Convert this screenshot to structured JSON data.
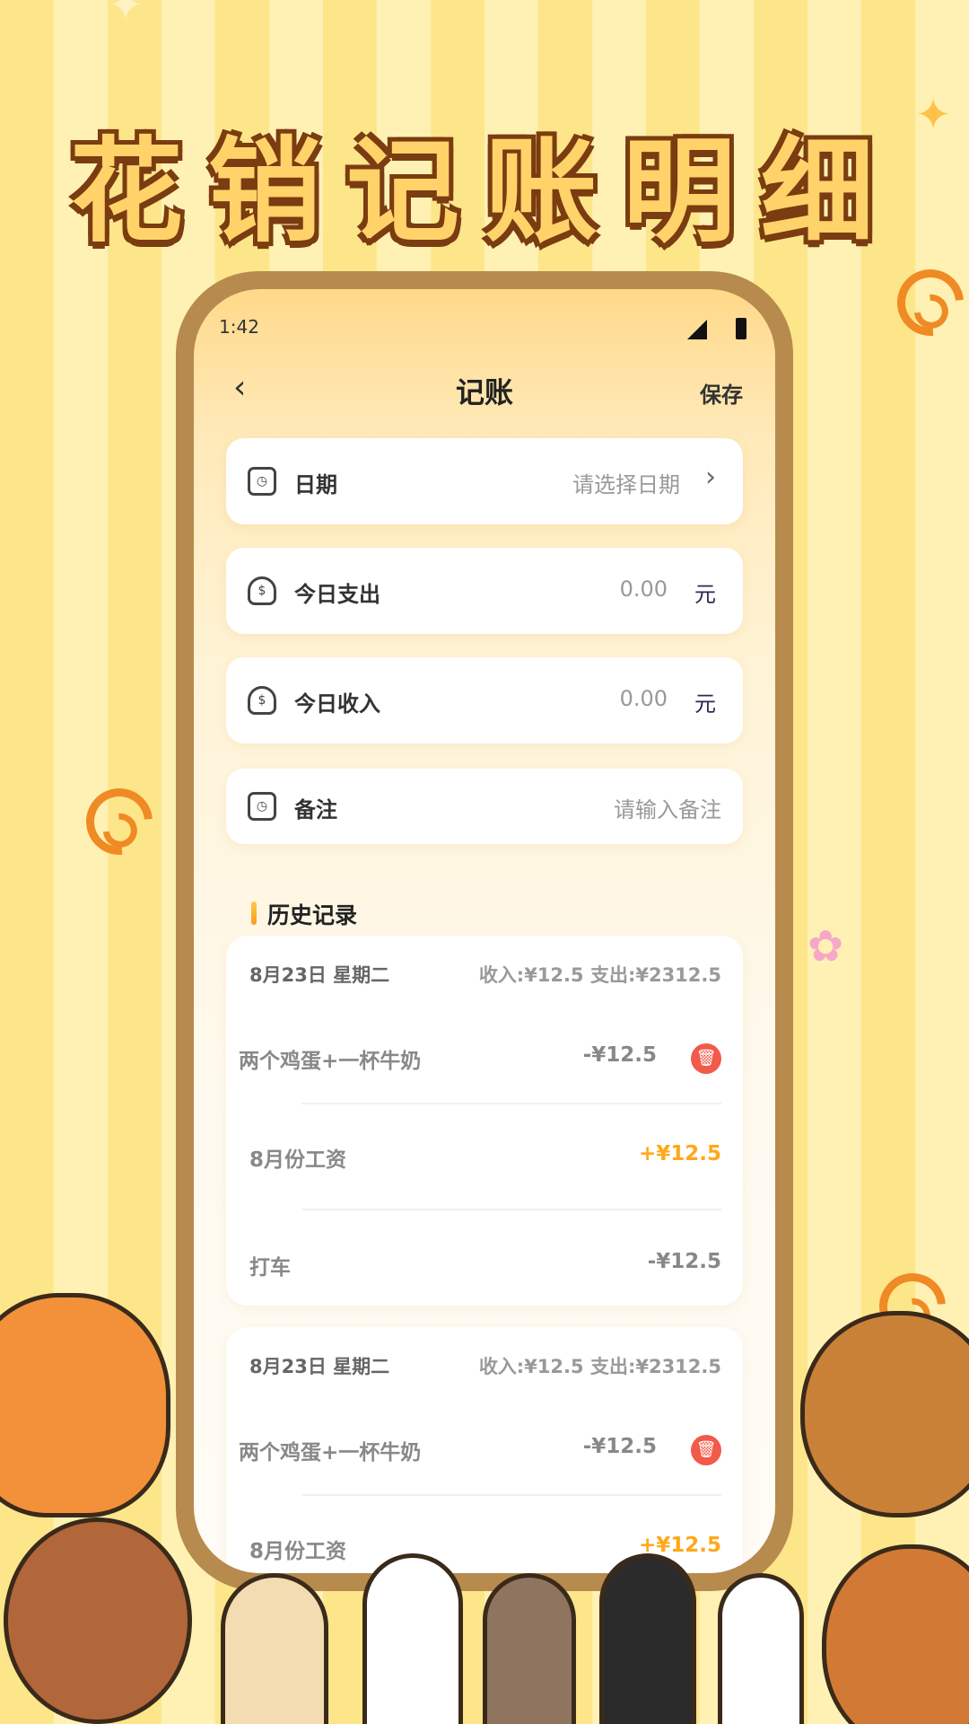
{
  "promo": {
    "title": "花销记账明细"
  },
  "status_bar": {
    "time": "1:42"
  },
  "nav": {
    "back_icon": "chevron-left-icon",
    "title": "记账",
    "save": "保存"
  },
  "form": {
    "date": {
      "label": "日期",
      "placeholder": "请选择日期",
      "icon": "clock-icon"
    },
    "expense": {
      "label": "今日支出",
      "value": "0.00",
      "unit": "元",
      "icon": "money-bag-icon"
    },
    "income": {
      "label": "今日收入",
      "value": "0.00",
      "unit": "元",
      "icon": "money-bag-icon"
    },
    "note": {
      "label": "备注",
      "placeholder": "请输入备注",
      "icon": "clock-icon"
    }
  },
  "history": {
    "title": "历史记录",
    "groups": [
      {
        "date": "8月23日  星期二",
        "summary": "收入:¥12.5   支出:¥2312.5",
        "items": [
          {
            "name": "两个鸡蛋+一杯牛奶",
            "amount": "-¥12.5",
            "type": "expense",
            "deletable": true
          },
          {
            "name": "8月份工资",
            "amount": "+¥12.5",
            "type": "income",
            "deletable": false
          },
          {
            "name": "打车",
            "amount": "-¥12.5",
            "type": "expense",
            "deletable": false
          }
        ]
      },
      {
        "date": "8月23日  星期二",
        "summary": "收入:¥12.5   支出:¥2312.5",
        "items": [
          {
            "name": "两个鸡蛋+一杯牛奶",
            "amount": "-¥12.5",
            "type": "expense",
            "deletable": true
          },
          {
            "name": "8月份工资",
            "amount": "+¥12.5",
            "type": "income",
            "deletable": false
          }
        ]
      }
    ]
  },
  "colors": {
    "accent": "#ffa81a",
    "delete": "#f25a4a",
    "frame": "#b78a4d"
  }
}
